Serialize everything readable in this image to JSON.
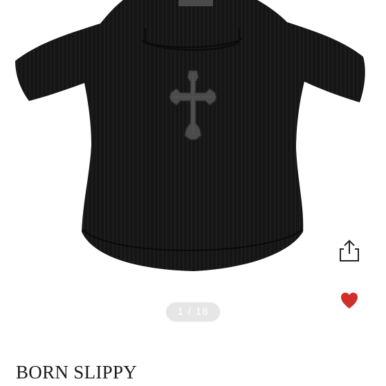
{
  "product": {
    "image_label": "black ribbed cross t-shirt",
    "brand": "BORN SLIPPY"
  },
  "gallery": {
    "current": "1",
    "separator": "/",
    "total": "18"
  },
  "actions": {
    "share_icon": "share-icon",
    "like_icon": "heart-icon"
  },
  "colors": {
    "shirt": "#151515",
    "heart": "#d0302c",
    "counter_bg": "#e6e6e6"
  }
}
